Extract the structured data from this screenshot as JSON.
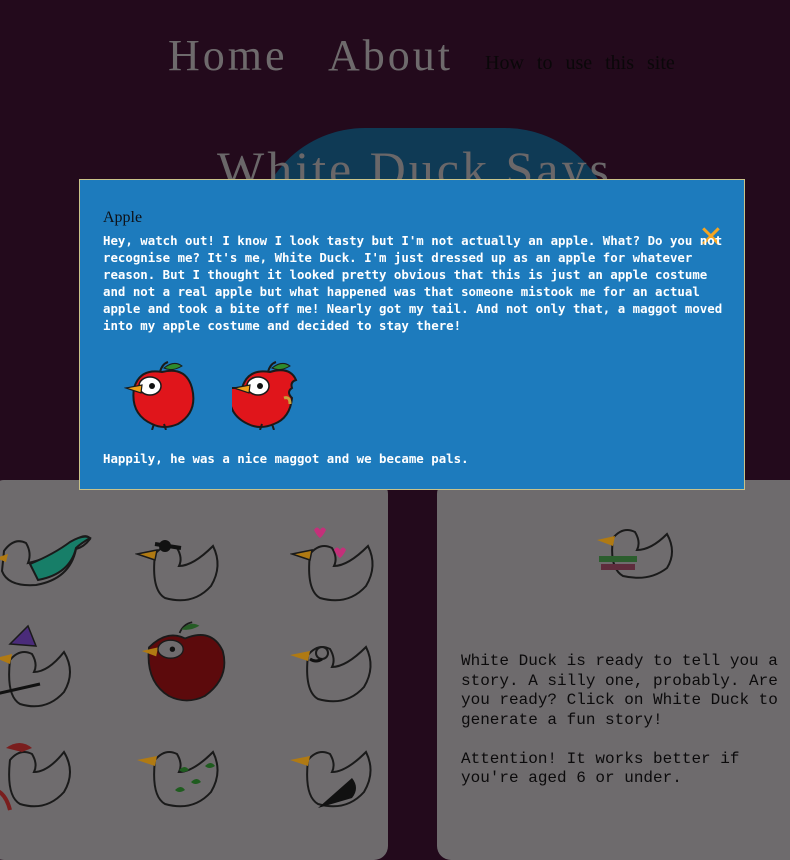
{
  "nav": {
    "home": "Home",
    "about": "About",
    "how_to": "How to use this site"
  },
  "banner": {
    "title": "White Duck Says"
  },
  "story_panel": {
    "intro": "White Duck is ready to tell you a story. A silly one, probably. Are you ready? Click on White Duck to generate a fun story!",
    "attention": "Attention! It works better if you're aged 6 or under."
  },
  "modal": {
    "title": "Apple",
    "body": "Hey, watch out! I know I look tasty but I'm not actually an apple. What? Do you not recognise me? It's me, White Duck. I'm just dressed up as an apple for whatever reason. But I thought it looked pretty obvious that this is just an apple costume and not a real apple but what happened was that someone mistook me for an actual apple and took a bite off me! Nearly got my tail. And not only that, a maggot moved into my apple costume and decided to stay there!",
    "footer": "Happily, he was a nice maggot and we became pals.",
    "close_icon": "close-icon"
  },
  "colors": {
    "page_bg": "#230a1c",
    "modal_bg": "#1d7bbd",
    "close": "#f5a623",
    "apple_red": "#e0151b"
  }
}
